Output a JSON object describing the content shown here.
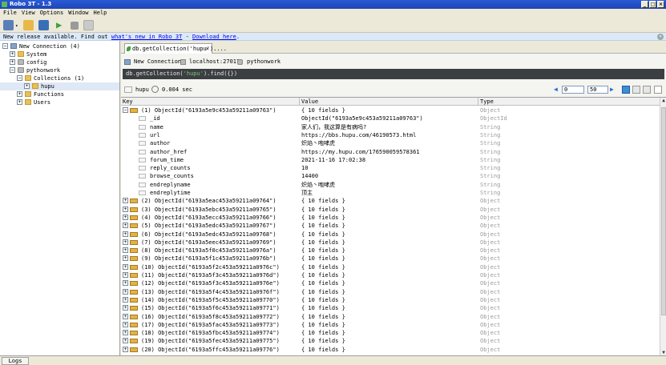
{
  "window": {
    "title": "Robo 3T - 1.3"
  },
  "menu": [
    "File",
    "View",
    "Options",
    "Window",
    "Help"
  ],
  "notice": {
    "prefix": "New release available. Find out ",
    "link1": "what's new in Robo 3T",
    "sep": " - ",
    "link2": "Download here",
    "suffix": "."
  },
  "tree": {
    "connection": "New Connection (4)",
    "system": "System",
    "config": "config",
    "db": "pythonwork",
    "collections": "Collections (1)",
    "collection": "hupu",
    "functions": "Functions",
    "users": "Users"
  },
  "tab": {
    "label": "db.getCollection('hupu')....",
    "close": "×"
  },
  "info": {
    "connection": "New Connection",
    "host": "localhost:27017",
    "db": "pythonwork"
  },
  "query": {
    "prefix": "db.getCollection(",
    "arg": "'hupu'",
    "suffix": ").find({})"
  },
  "result": {
    "collection": "hupu",
    "time": "0.004 sec",
    "page_from": "0",
    "page_size": "50"
  },
  "grid": {
    "headers": {
      "key": "Key",
      "value": "Value",
      "type": "Type"
    },
    "expanded": {
      "key": "(1) ObjectId(\"6193a5e9c453a59211a09763\")",
      "value": "{ 10 fields }",
      "type": "Object",
      "fields": [
        {
          "key": "_id",
          "value": "ObjectId(\"6193a5e9c453a59211a09763\")",
          "type": "ObjectId"
        },
        {
          "key": "name",
          "value": "家人们，我这算是有病吗?",
          "type": "String"
        },
        {
          "key": "url",
          "value": "https://bbs.hupu.com/46190573.html",
          "type": "String"
        },
        {
          "key": "author",
          "value": "炽焰丶咆哮虎",
          "type": "String"
        },
        {
          "key": "author_href",
          "value": "https://my.hupu.com/176590059578361",
          "type": "String"
        },
        {
          "key": "forum_time",
          "value": "2021-11-16 17:02:38",
          "type": "String"
        },
        {
          "key": "reply_counts",
          "value": "10",
          "type": "String"
        },
        {
          "key": "browse_counts",
          "value": "14400",
          "type": "String"
        },
        {
          "key": "endreplyname",
          "value": "炽焰丶咆哮虎",
          "type": "String"
        },
        {
          "key": "endreplytime",
          "value": "顶主",
          "type": "String"
        }
      ]
    },
    "docs": [
      {
        "key": "(2) ObjectId(\"6193a5eac453a59211a09764\")",
        "value": "{ 10 fields }",
        "type": "Object"
      },
      {
        "key": "(3) ObjectId(\"6193a5ebc453a59211a09765\")",
        "value": "{ 10 fields }",
        "type": "Object"
      },
      {
        "key": "(4) ObjectId(\"6193a5ecc453a59211a09766\")",
        "value": "{ 10 fields }",
        "type": "Object"
      },
      {
        "key": "(5) ObjectId(\"6193a5edc453a59211a09767\")",
        "value": "{ 10 fields }",
        "type": "Object"
      },
      {
        "key": "(6) ObjectId(\"6193a5edc453a59211a09768\")",
        "value": "{ 10 fields }",
        "type": "Object"
      },
      {
        "key": "(7) ObjectId(\"6193a5eec453a59211a09769\")",
        "value": "{ 10 fields }",
        "type": "Object"
      },
      {
        "key": "(8) ObjectId(\"6193a5f0c453a59211a0976a\")",
        "value": "{ 10 fields }",
        "type": "Object"
      },
      {
        "key": "(9) ObjectId(\"6193a5f1c453a59211a0976b\")",
        "value": "{ 10 fields }",
        "type": "Object"
      },
      {
        "key": "(10) ObjectId(\"6193a5f2c453a59211a0976c\")",
        "value": "{ 10 fields }",
        "type": "Object"
      },
      {
        "key": "(11) ObjectId(\"6193a5f3c453a59211a0976d\")",
        "value": "{ 10 fields }",
        "type": "Object"
      },
      {
        "key": "(12) ObjectId(\"6193a5f3c453a59211a0976e\")",
        "value": "{ 10 fields }",
        "type": "Object"
      },
      {
        "key": "(13) ObjectId(\"6193a5f4c453a59211a0976f\")",
        "value": "{ 10 fields }",
        "type": "Object"
      },
      {
        "key": "(14) ObjectId(\"6193a5f5c453a59211a09770\")",
        "value": "{ 10 fields }",
        "type": "Object"
      },
      {
        "key": "(15) ObjectId(\"6193a5f6c453a59211a09771\")",
        "value": "{ 10 fields }",
        "type": "Object"
      },
      {
        "key": "(16) ObjectId(\"6193a5f8c453a59211a09772\")",
        "value": "{ 10 fields }",
        "type": "Object"
      },
      {
        "key": "(17) ObjectId(\"6193a5fac453a59211a09773\")",
        "value": "{ 10 fields }",
        "type": "Object"
      },
      {
        "key": "(18) ObjectId(\"6193a5fbc453a59211a09774\")",
        "value": "{ 10 fields }",
        "type": "Object"
      },
      {
        "key": "(19) ObjectId(\"6193a5fec453a59211a09775\")",
        "value": "{ 10 fields }",
        "type": "Object"
      },
      {
        "key": "(20) ObjectId(\"6193a5ffc453a59211a09776\")",
        "value": "{ 10 fields }",
        "type": "Object"
      }
    ]
  },
  "status": {
    "logs": "Logs"
  }
}
